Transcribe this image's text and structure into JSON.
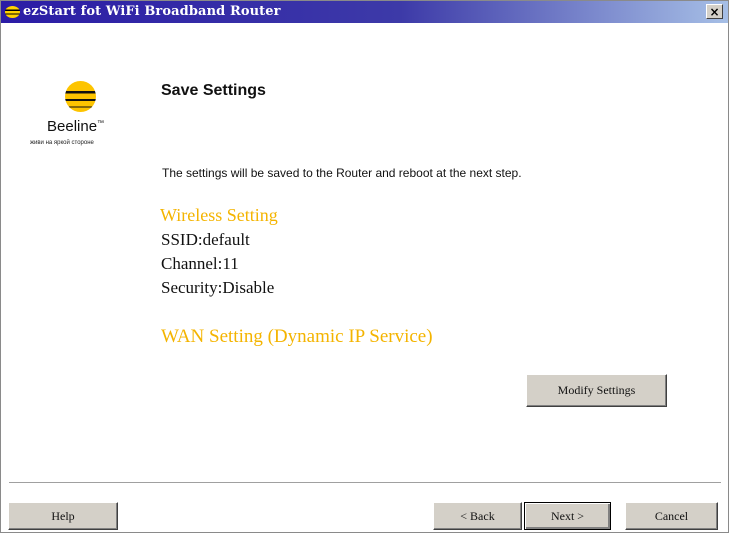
{
  "window": {
    "title": "ezStart fot WiFi Broadband Router",
    "close_label": "×"
  },
  "logo": {
    "name": "Beeline",
    "trademark": "™",
    "slogan": "живи на яркой стороне"
  },
  "page": {
    "heading": "Save Settings",
    "description": "The settings will be saved to the Router and reboot at the next step."
  },
  "wireless": {
    "title": "Wireless Setting",
    "ssid": "SSID:default",
    "channel": "Channel:11",
    "security": "Security:Disable"
  },
  "wan": {
    "title": "WAN Setting  (Dynamic IP Service)"
  },
  "buttons": {
    "modify": "Modify Settings",
    "help": "Help",
    "back": "< Back",
    "next": "Next >",
    "cancel": "Cancel"
  },
  "colors": {
    "accent_yellow": "#f4b400",
    "titlebar": "#2b1ca6"
  }
}
